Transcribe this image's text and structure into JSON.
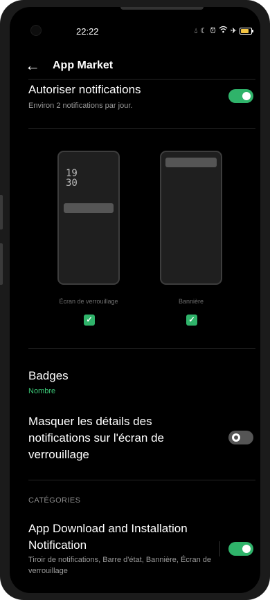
{
  "status": {
    "time": "22:22",
    "icons": [
      "drop-icon",
      "moon-icon",
      "alarm-icon",
      "wifi-icon",
      "airplane-icon",
      "battery-icon"
    ]
  },
  "header": {
    "title": "App Market",
    "back_icon": "arrow-left-icon"
  },
  "allow_notifications": {
    "title": "Autoriser notifications",
    "subtitle": "Environ 2 notifications par jour.",
    "enabled": true
  },
  "previews": {
    "lockscreen": {
      "clock_hour": "19",
      "clock_minute": "30",
      "label": "Écran de verrouillage",
      "checked": true
    },
    "banner": {
      "label": "Bannière",
      "checked": true
    }
  },
  "badges": {
    "title": "Badges",
    "value": "Nombre"
  },
  "hide_details": {
    "title": "Masquer les détails des notifications sur l'écran de verrouillage",
    "enabled": false
  },
  "categories": {
    "header": "CATÉGORIES",
    "items": [
      {
        "title": "App Download and Installation Notification",
        "subtitle": "Tiroir de notifications, Barre d'état, Bannière, Écran de verrouillage",
        "enabled": true
      }
    ]
  },
  "colors": {
    "accent": "#2fb36a",
    "accent_text": "#3cc978",
    "background": "#000000"
  }
}
